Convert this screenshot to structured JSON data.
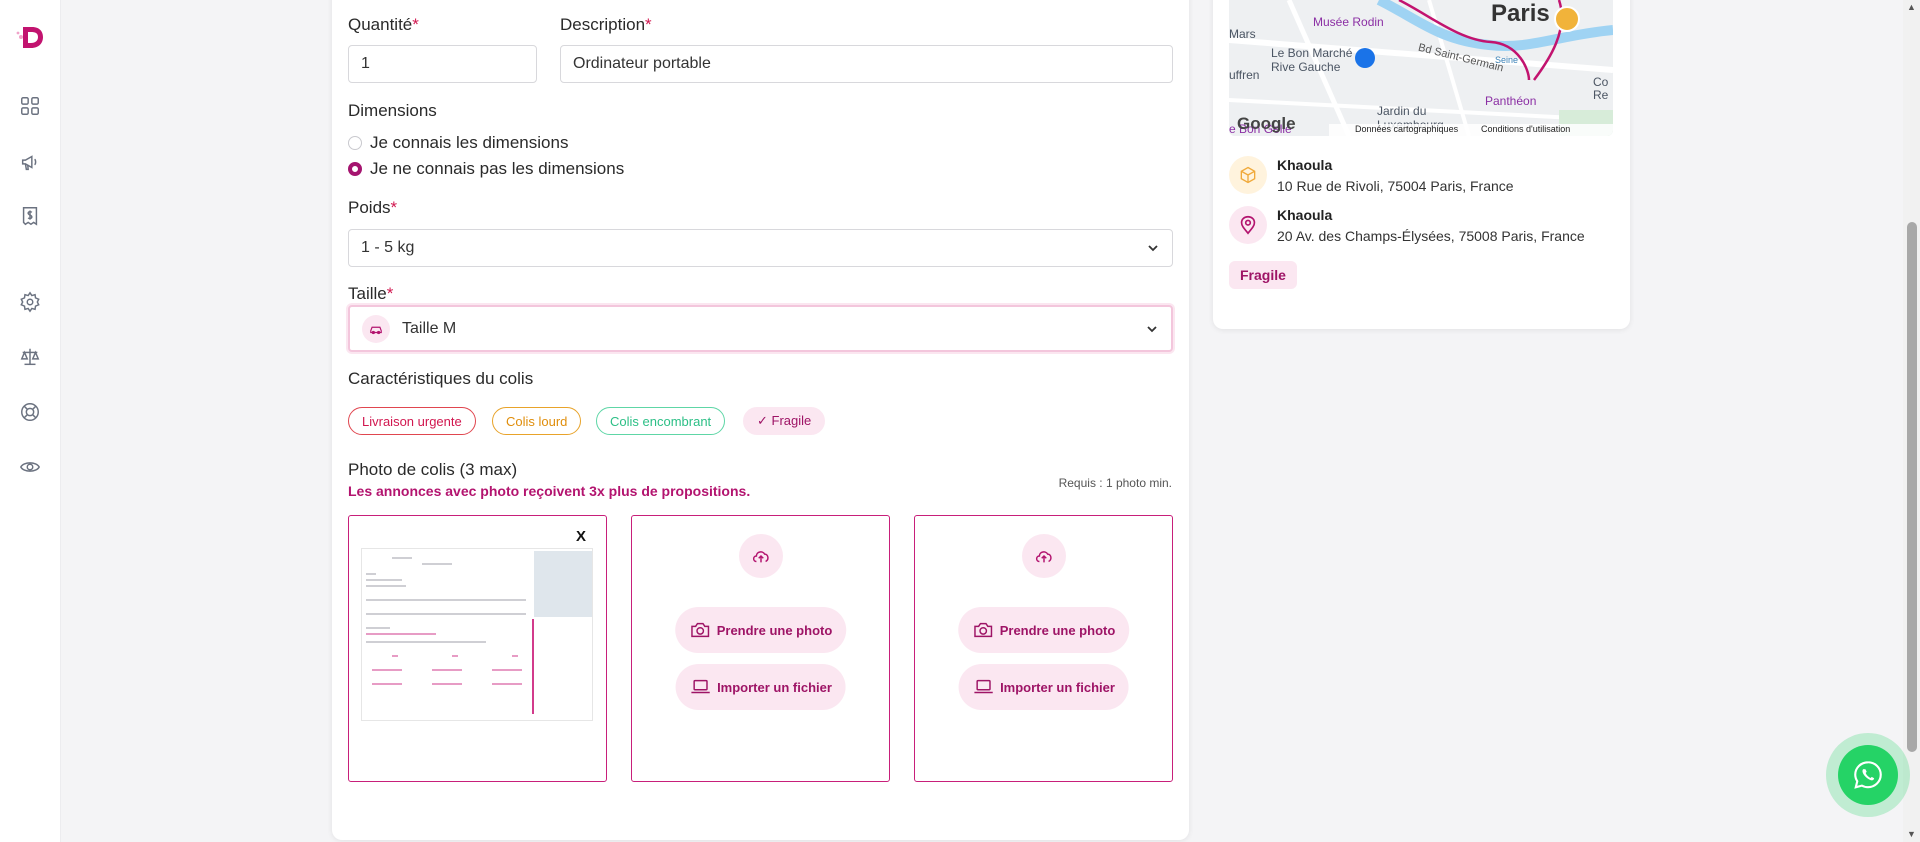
{
  "form": {
    "quantity": {
      "label": "Quantité",
      "required_mark": "*",
      "value": "1"
    },
    "description": {
      "label": "Description",
      "required_mark": "*",
      "value": "Ordinateur portable"
    },
    "dimensions": {
      "label": "Dimensions",
      "options": [
        {
          "label": "Je connais les dimensions",
          "checked": false
        },
        {
          "label": "Je ne connais pas les dimensions",
          "checked": true
        }
      ]
    },
    "weight": {
      "label": "Poids",
      "required_mark": "*",
      "selected": "1 - 5 kg"
    },
    "size": {
      "label": "Taille",
      "required_mark": "*",
      "selected": "Taille M"
    },
    "characteristics": {
      "label": "Caractéristiques du colis",
      "chips": [
        {
          "label": "Livraison urgente",
          "selected": false,
          "color": "#d1174f"
        },
        {
          "label": "Colis lourd",
          "selected": false,
          "color": "#e08e0b"
        },
        {
          "label": "Colis encombrant",
          "selected": false,
          "color": "#2cbf86"
        },
        {
          "label": "✓ Fragile",
          "selected": true,
          "color": "#9e1466"
        }
      ]
    },
    "photos": {
      "label": "Photo de colis (3 max)",
      "promo": "Les annonces avec photo reçoivent 3x plus de propositions.",
      "requirement": "Requis : 1 photo min.",
      "remove_label": "X",
      "take_photo_label": "Prendre une photo",
      "import_file_label": "Importer un fichier"
    }
  },
  "summary": {
    "map": {
      "labels": {
        "city": "Paris",
        "museum": "Musée Rodin",
        "bon_marche": "Le Bon Marché Rive Gauche",
        "street": "Bd Saint-Germain",
        "pantheon": "Panthéon",
        "jardin": "Jardin du Luxembourg",
        "mars": "Mars",
        "uffren": "uffren",
        "edge": "Co Re",
        "seine": "Seine",
        "bottom": "e Bon Gelle"
      },
      "footer": {
        "brand": "Google",
        "data": "Données cartographiques",
        "terms": "Conditions d'utilisation"
      }
    },
    "pickup": {
      "name": "Khaoula",
      "address": "10 Rue de Rivoli, 75004 Paris, France",
      "icon": "package-icon"
    },
    "dropoff": {
      "name": "Khaoula",
      "address": "20 Av. des Champs-Élysées, 75008 Paris, France",
      "icon": "location-pin-icon"
    },
    "tag": "Fragile"
  },
  "colors": {
    "brand": "#b3146f",
    "brand_light": "#fbe7f1",
    "required": "#d1174f",
    "whatsapp": "#25d366"
  }
}
